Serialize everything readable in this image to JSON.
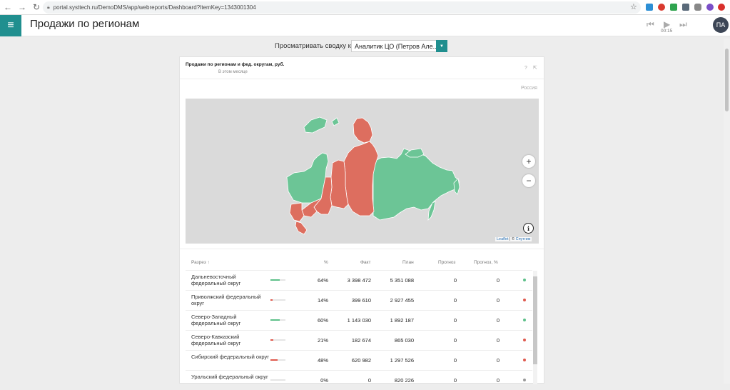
{
  "browser": {
    "url": "portal.systtech.ru/DemoDMS/app/webreports/Dashboard?ItemKey=1343001304"
  },
  "header": {
    "title": "Продажи по регионам",
    "timer": "00:15",
    "avatar": "ПА"
  },
  "filter": {
    "label": "Просматривать сводку как",
    "value": "Аналитик ЦО (Петров Але..."
  },
  "widget": {
    "title": "Продажи по регионам и фед. округам, руб.",
    "subtitle": "В этом месяце",
    "map_region": "Россия",
    "zoom_in": "+",
    "zoom_out": "−",
    "info": "i",
    "attribution_leaflet": "Leaflet",
    "attribution_sep": " | © ",
    "attribution_provider": "Спутник"
  },
  "table": {
    "headers": {
      "name": "Разрез ↑",
      "pct": "%",
      "fact": "Факт",
      "plan": "План",
      "forecast": "Прогноз",
      "forecast_pct": "Прогноз, %"
    },
    "rows": [
      {
        "name": "Дальневосточный федеральный округ",
        "pct": "64%",
        "fact": "3 398 472",
        "plan": "5 351 088",
        "forecast": "0",
        "forecast_pct": "0",
        "progress": 0.64,
        "status": "#5ec08a"
      },
      {
        "name": "Приволжский федеральный округ",
        "pct": "14%",
        "fact": "399 610",
        "plan": "2 927 455",
        "forecast": "0",
        "forecast_pct": "0",
        "progress": 0.14,
        "status": "#e05a4e"
      },
      {
        "name": "Северо-Западный федеральный округ",
        "pct": "60%",
        "fact": "1 143 030",
        "plan": "1 892 187",
        "forecast": "0",
        "forecast_pct": "0",
        "progress": 0.6,
        "status": "#5ec08a"
      },
      {
        "name": "Северо-Кавказский федеральный округ",
        "pct": "21%",
        "fact": "182 674",
        "plan": "865 030",
        "forecast": "0",
        "forecast_pct": "0",
        "progress": 0.21,
        "status": "#e05a4e"
      },
      {
        "name": "Сибирский федеральный округ",
        "pct": "48%",
        "fact": "620 982",
        "plan": "1 297 526",
        "forecast": "0",
        "forecast_pct": "0",
        "progress": 0.48,
        "status": "#e05a4e"
      },
      {
        "name": "Уральский федеральный округ",
        "pct": "0%",
        "fact": "0",
        "plan": "820 226",
        "forecast": "0",
        "forecast_pct": "0",
        "progress": 0,
        "status": "#9a9a9a"
      }
    ]
  },
  "colors": {
    "accent": "#208f8f",
    "good": "#6cc596",
    "bad": "#dd6e5f",
    "good_bar": "#5ec08a",
    "bad_bar": "#e05a4e"
  }
}
